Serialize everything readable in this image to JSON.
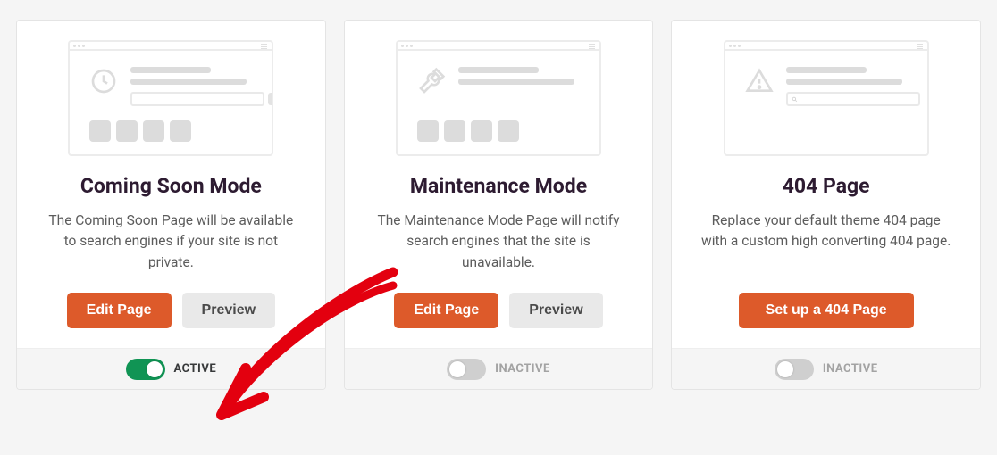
{
  "cards": [
    {
      "title": "Coming Soon Mode",
      "desc": "The Coming Soon Page will be available to search engines if your site is not private.",
      "primary": "Edit Page",
      "secondary": "Preview",
      "toggle_on": true,
      "status": "ACTIVE",
      "icon": "clock"
    },
    {
      "title": "Maintenance Mode",
      "desc": "The Maintenance Mode Page will notify search engines that the site is unavailable.",
      "primary": "Edit Page",
      "secondary": "Preview",
      "toggle_on": false,
      "status": "INACTIVE",
      "icon": "tools"
    },
    {
      "title": "404 Page",
      "desc": "Replace your default theme 404 page with a custom high converting 404 page.",
      "primary": "Set up a 404 Page",
      "secondary": null,
      "toggle_on": false,
      "status": "INACTIVE",
      "icon": "warning"
    }
  ],
  "colors": {
    "accent": "#dd5a2a",
    "active": "#109454"
  }
}
